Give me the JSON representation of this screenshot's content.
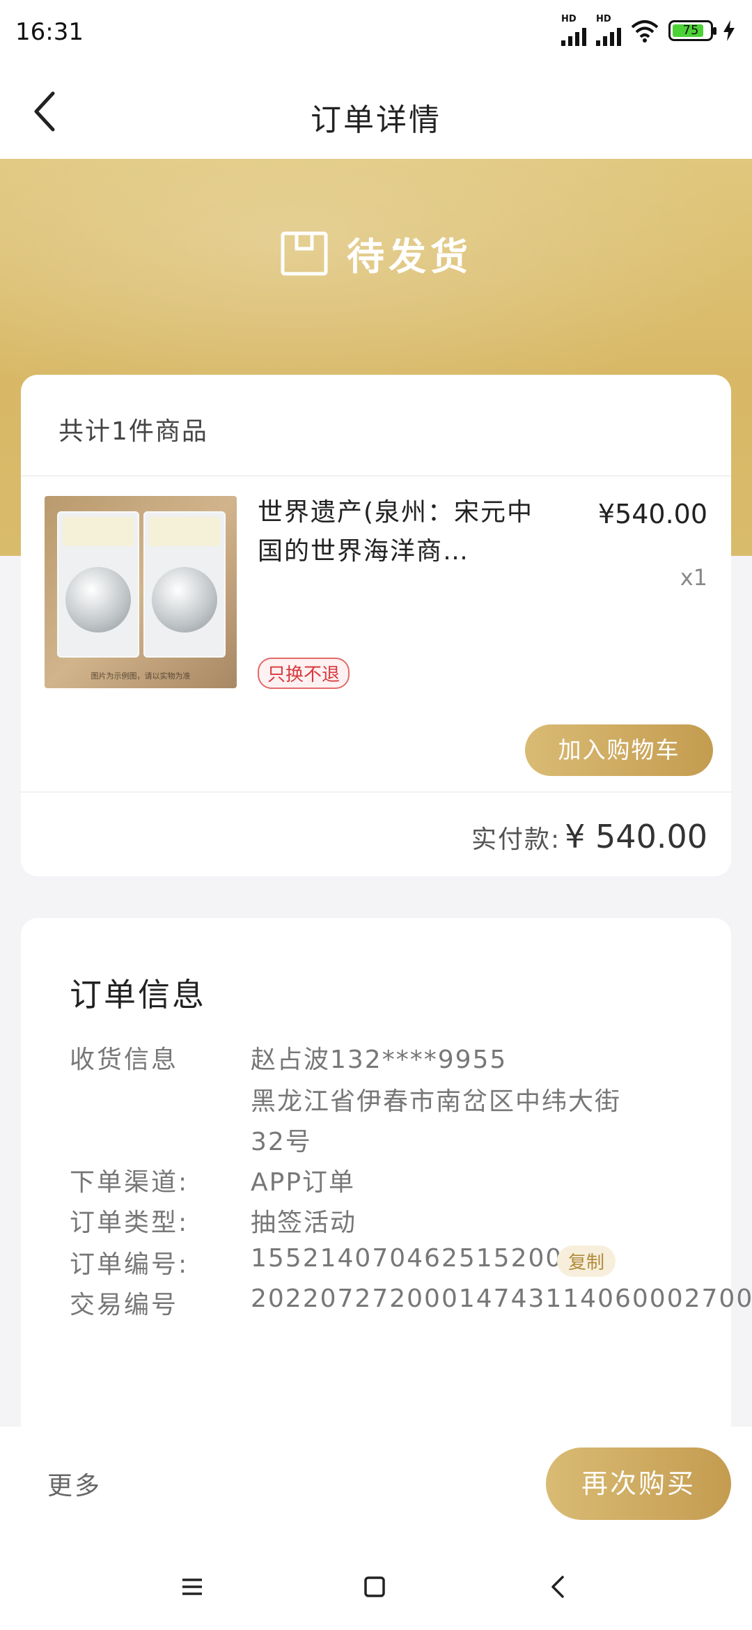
{
  "status_bar": {
    "time": "16:31",
    "battery_level": "75",
    "network_label": "HD"
  },
  "nav": {
    "title": "订单详情"
  },
  "hero": {
    "status": "待发货"
  },
  "goods": {
    "count_text": "共计1件商品",
    "items": [
      {
        "name": "世界遗产(泉州：宋元中国的世界海洋商…",
        "price": "¥540.00",
        "qty": "x1",
        "policy_badge": "只换不退",
        "image_caption": "图片为示例图，请以实物为准"
      }
    ],
    "add_cart_label": "加入购物车",
    "paid_label": "实付款:",
    "paid_value": "¥ 540.00"
  },
  "order_info": {
    "title": "订单信息",
    "receiver_label": "收货信息",
    "receiver_name_phone": "赵占波132****9955",
    "receiver_address_line1": "黑龙江省伊春市南岔区中纬大街",
    "receiver_address_line2": "32号",
    "channel_label": "下单渠道:",
    "channel_value": "APP订单",
    "type_label": "订单类型:",
    "type_value": "抽签活动",
    "number_label": "订单编号:",
    "number_value": "1552140704625152001",
    "copy_label": "复制",
    "partial_label": "交易编号",
    "partial_value": "20220727200014743114060002700"
  },
  "bottom_bar": {
    "more_label": "更多",
    "rebuy_label": "再次购买"
  },
  "colors": {
    "gold": "#d4b364",
    "gold_dark": "#c49c50",
    "badge_red": "#d8383e"
  }
}
